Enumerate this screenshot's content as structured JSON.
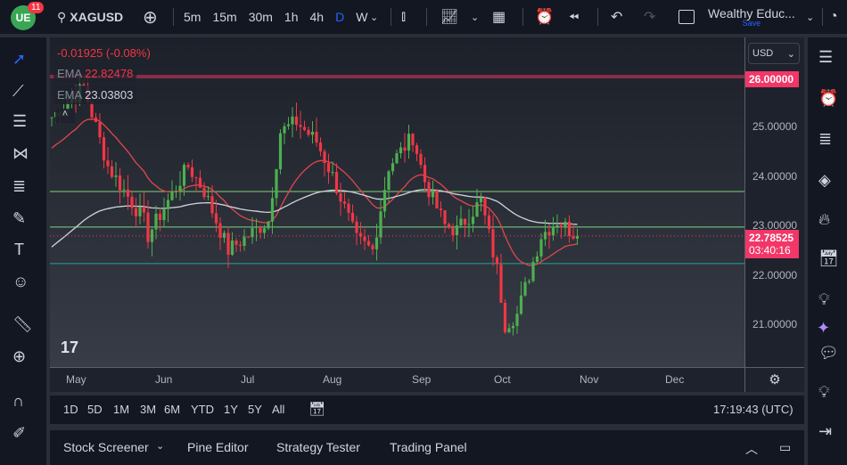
{
  "header": {
    "notifications": "11",
    "symbol": "XAGUSD",
    "intervals": [
      "5m",
      "15m",
      "30m",
      "1h",
      "4h",
      "D",
      "W"
    ],
    "active_interval": "D",
    "layout_name": "Wealthy Educ...",
    "save_label": "Save"
  },
  "legend": {
    "change": "-0.01925 (-0.08%)",
    "ema1_label": "EMA",
    "ema1_value": "22.82478",
    "ema2_label": "EMA",
    "ema2_value": "23.03803"
  },
  "price_axis": {
    "currency": "USD",
    "ticks": [
      "26.00000",
      "25.00000",
      "24.00000",
      "23.00000",
      "22.00000",
      "21.00000"
    ],
    "current_price": "22.78525",
    "countdown": "03:40:16",
    "alert_price": "26.00000"
  },
  "time_axis": {
    "months": [
      "May",
      "Jun",
      "Jul",
      "Aug",
      "Sep",
      "Oct",
      "Nov",
      "Dec"
    ]
  },
  "ranges": [
    "1D",
    "5D",
    "1M",
    "3M",
    "6M",
    "YTD",
    "1Y",
    "5Y",
    "All"
  ],
  "clock": "17:19:43 (UTC)",
  "bottom_tabs": [
    "Stock Screener",
    "Pine Editor",
    "Strategy Tester",
    "Trading Panel"
  ],
  "chart_data": {
    "type": "candlestick",
    "symbol": "XAGUSD",
    "timeframe": "D",
    "ylim": [
      20.4,
      26.6
    ],
    "keypoints": [
      [
        0,
        25.2
      ],
      [
        8,
        25.8
      ],
      [
        14,
        24.2
      ],
      [
        23,
        23.1
      ],
      [
        24,
        22.8
      ],
      [
        34,
        24.2
      ],
      [
        38,
        23.7
      ],
      [
        44,
        22.5
      ],
      [
        54,
        23.1
      ],
      [
        57,
        24.9
      ],
      [
        61,
        25.1
      ],
      [
        66,
        24.7
      ],
      [
        70,
        24.0
      ],
      [
        76,
        22.7
      ],
      [
        80,
        22.5
      ],
      [
        84,
        24.2
      ],
      [
        90,
        24.8
      ],
      [
        93,
        23.9
      ],
      [
        98,
        23.0
      ],
      [
        101,
        22.9
      ],
      [
        107,
        23.5
      ],
      [
        111,
        22.1
      ],
      [
        113,
        21.0
      ],
      [
        116,
        21.2
      ],
      [
        119,
        22.0
      ],
      [
        122,
        22.8
      ],
      [
        126,
        23.1
      ],
      [
        131,
        22.79
      ]
    ],
    "levels": [
      {
        "price": 26.0,
        "color": "#f23668"
      },
      {
        "price": 23.69,
        "color": "#7ed37e"
      },
      {
        "price": 22.97,
        "color": "#7ed37e"
      },
      {
        "price": 22.23,
        "color": "#26a69a"
      }
    ],
    "colors": {
      "up": "#4caf50",
      "down": "#f23645",
      "ema_fast": "#e0474c",
      "ema_slow": "#d1d4dc"
    }
  }
}
